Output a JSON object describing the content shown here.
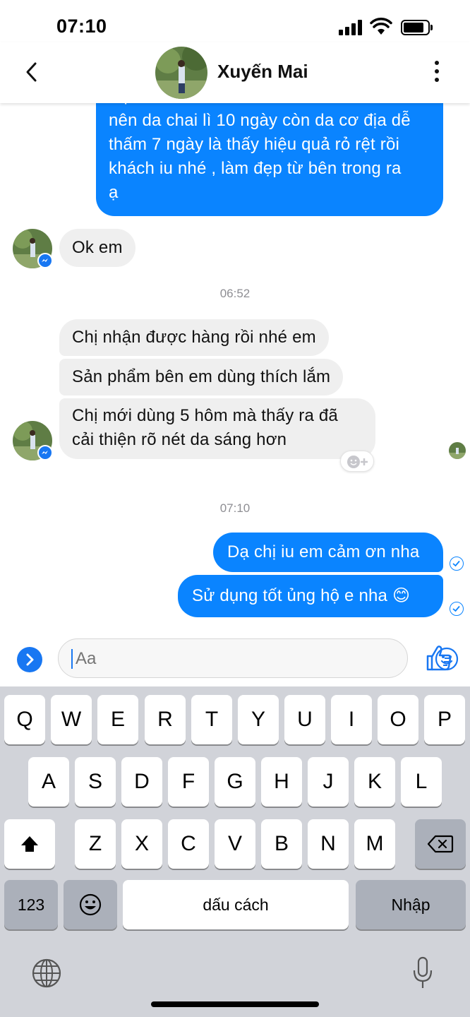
{
  "status_bar": {
    "time": "07:10"
  },
  "header": {
    "contact_name": "Xuyến Mai"
  },
  "messages": {
    "outgoing_1": [
      "Dạ kem bên em thấm vào da rất nhanh",
      "nên da chai lì 10 ngày còn da cơ địa dễ",
      "thấm 7 ngày là thấy hiệu quả rỏ rệt rồi",
      "khách iu nhé , làm đẹp từ bên trong ra",
      "ạ"
    ],
    "incoming_1": "Ok em",
    "timestamp_1": "06:52",
    "incoming_2": "Chị nhận được hàng rồi nhé em",
    "incoming_3": "Sản phẩm bên em dùng thích lắm",
    "incoming_4": [
      "Chị mới dùng 5  hôm mà thấy ra đã",
      "cải thiện rõ  nét da sáng hơn"
    ],
    "timestamp_2": "07:10",
    "outgoing_2": "Dạ chị iu em cảm ơn nha",
    "outgoing_3": "Sử dụng tốt ủng hộ e nha 😊"
  },
  "composer": {
    "placeholder": "Aa"
  },
  "keyboard": {
    "row1": [
      "Q",
      "W",
      "E",
      "R",
      "T",
      "Y",
      "U",
      "I",
      "O",
      "P"
    ],
    "row2": [
      "A",
      "S",
      "D",
      "F",
      "G",
      "H",
      "J",
      "K",
      "L"
    ],
    "row3": [
      "Z",
      "X",
      "C",
      "V",
      "B",
      "N",
      "M"
    ],
    "numbers_label": "123",
    "space_label": "dấu cách",
    "return_label": "Nhập"
  },
  "colors": {
    "accent": "#0a84ff",
    "incoming_bubble": "#efefef",
    "keyboard_bg": "#d1d3d9"
  },
  "icons": [
    "back-chevron-icon",
    "more-vertical-icon",
    "messenger-badge-icon",
    "read-check-icon",
    "add-reaction-icon",
    "expand-arrow-icon",
    "emoji-icon",
    "thumbs-up-icon",
    "shift-icon",
    "backspace-icon",
    "emoji-keyboard-icon",
    "globe-icon",
    "microphone-icon"
  ]
}
